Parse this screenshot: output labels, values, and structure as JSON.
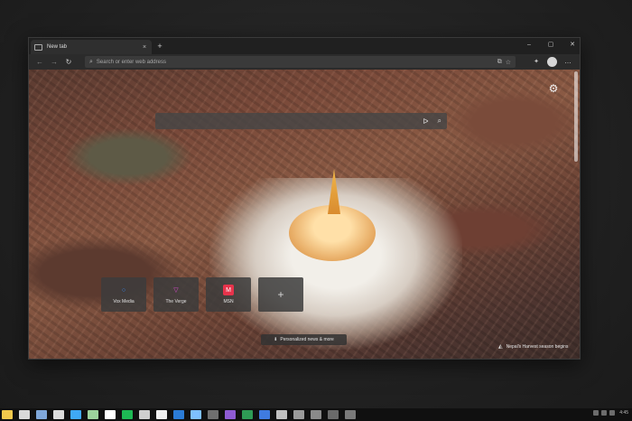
{
  "browser": {
    "tab_title": "New tab",
    "tab_close": "×",
    "new_tab": "+",
    "window_controls": [
      "–",
      "▢",
      "✕"
    ]
  },
  "toolbar": {
    "back": "←",
    "forward": "→",
    "refresh": "↻",
    "address_placeholder": "Search or enter web address",
    "right_icons": [
      "⧉",
      "☆",
      "✦"
    ],
    "menu": "…"
  },
  "page": {
    "settings_icon": "⚙",
    "quick_links": [
      {
        "label": "Vox Media",
        "icon": "○",
        "color": "#2f8cff"
      },
      {
        "label": "The Verge",
        "icon": "▽",
        "color": "#e34bd8"
      },
      {
        "label": "MSN",
        "icon": "M",
        "color": "#e7334b"
      }
    ],
    "add_tile": "+",
    "news_button": "Personalized news & more",
    "image_credit": "Nepal's Harvest season begins"
  },
  "taskbar": {
    "icons": [
      "#f2c94c",
      "#d9d9d9",
      "#7fa7d9",
      "#dcdcdc",
      "#3fa9f5",
      "#9dd39d",
      "#ffffff",
      "#1db954",
      "#cfcfcf",
      "#f0f0f0",
      "#2b7bd6",
      "#7ec0ff",
      "#6f6f6f",
      "#8e5bd3",
      "#2e9b55",
      "#3f7be0",
      "#c0c0c0",
      "#9a9a9a",
      "#8a8a8a",
      "#6a6a6a",
      "#7a7a7a"
    ],
    "clock": "4:45"
  }
}
